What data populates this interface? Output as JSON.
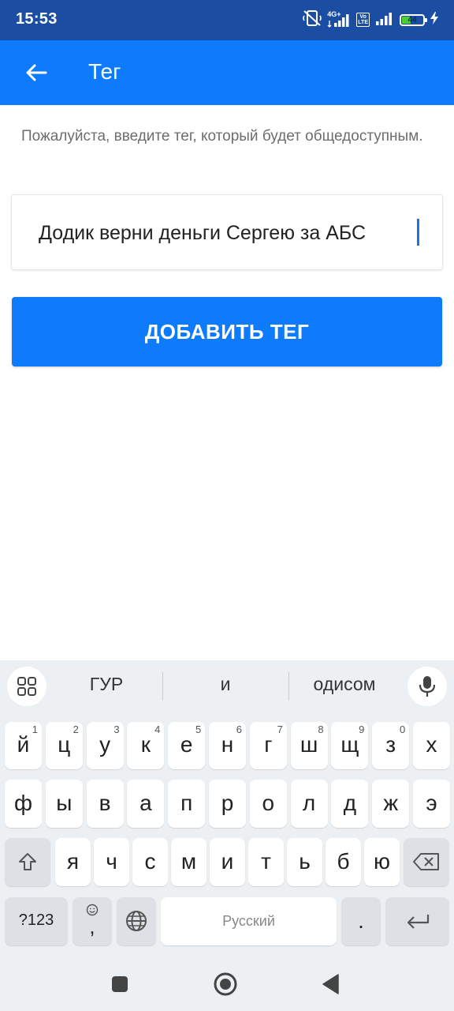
{
  "status_bar": {
    "time": "15:53",
    "network_type": "4G+",
    "volte_top": "Vo",
    "volte_bottom": "LTE",
    "battery_level": "44",
    "battery_fraction": 0.44,
    "icons": [
      "mute-icon",
      "signal-icon",
      "volte-icon",
      "signal-icon",
      "battery-icon",
      "charging-icon"
    ]
  },
  "app_bar": {
    "title": "Тег",
    "back_icon": "arrow-left-icon"
  },
  "form": {
    "hint": "Пожалуйста, введите тег, который будет общедоступным.",
    "tag_value": "Додик верни деньги Сергею за АБС",
    "submit_label": "ДОБАВИТЬ ТЕГ"
  },
  "keyboard": {
    "suggestions": [
      "ГУР",
      "и",
      "одисом"
    ],
    "row1": [
      {
        "l": "й",
        "n": "1"
      },
      {
        "l": "ц",
        "n": "2"
      },
      {
        "l": "у",
        "n": "3"
      },
      {
        "l": "к",
        "n": "4"
      },
      {
        "l": "е",
        "n": "5"
      },
      {
        "l": "н",
        "n": "6"
      },
      {
        "l": "г",
        "n": "7"
      },
      {
        "l": "ш",
        "n": "8"
      },
      {
        "l": "щ",
        "n": "9"
      },
      {
        "l": "з",
        "n": "0"
      },
      {
        "l": "х",
        "n": ""
      }
    ],
    "row2": [
      "ф",
      "ы",
      "в",
      "а",
      "п",
      "р",
      "о",
      "л",
      "д",
      "ж",
      "э"
    ],
    "row3": [
      "я",
      "ч",
      "с",
      "м",
      "и",
      "т",
      "ь",
      "б",
      "ю"
    ],
    "symbols_label": "?123",
    "comma_label": ",",
    "space_label": "Русский",
    "period_label": "."
  },
  "colors": {
    "status_bar": "#1b4ea3",
    "accent": "#0e7bfc",
    "keyboard_bg": "#edf0f2"
  }
}
